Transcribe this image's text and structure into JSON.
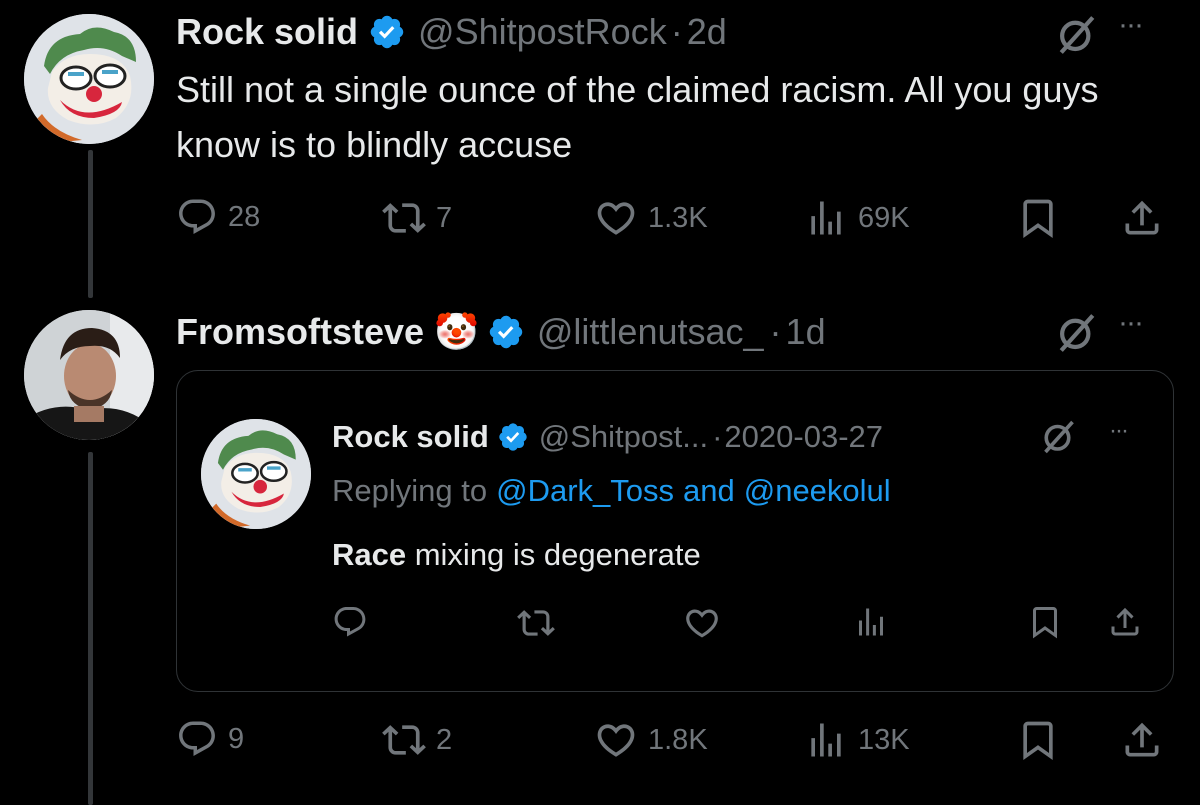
{
  "tweet1": {
    "name": "Rock solid",
    "handle": "@ShitpostRock",
    "sep": "·",
    "time": "2d",
    "text": "Still not a single ounce of the claimed racism. All you guys know is to blindly accuse",
    "stats": {
      "replies": "28",
      "reposts": "7",
      "likes": "1.3K",
      "views": "69K"
    }
  },
  "tweet2": {
    "name": "Fromsoftsteve",
    "name_emoji": "🤡",
    "handle": "@littlenutsac_",
    "sep": "·",
    "time": "1d",
    "stats": {
      "replies": "9",
      "reposts": "2",
      "likes": "1.8K",
      "views": "13K"
    }
  },
  "quoted": {
    "name": "Rock solid",
    "handle": "@Shitpost...",
    "sep": "·",
    "date": "2020-03-27",
    "replying_prefix": "Replying to",
    "mention1": "@Dark_Toss",
    "and": "and",
    "mention2": "@neekolul",
    "text_bold": "Race",
    "text_rest": " mixing is degenerate"
  },
  "more_glyph": "···",
  "colors": {
    "background": "#000000",
    "text": "#e7e9ea",
    "muted": "#71767b",
    "accent": "#1d9bf0",
    "border": "#2f3336"
  },
  "icons": [
    "reply-icon",
    "repost-icon",
    "like-icon",
    "views-icon",
    "bookmark-icon",
    "share-icon",
    "grok-icon",
    "more-icon",
    "verified-icon"
  ]
}
